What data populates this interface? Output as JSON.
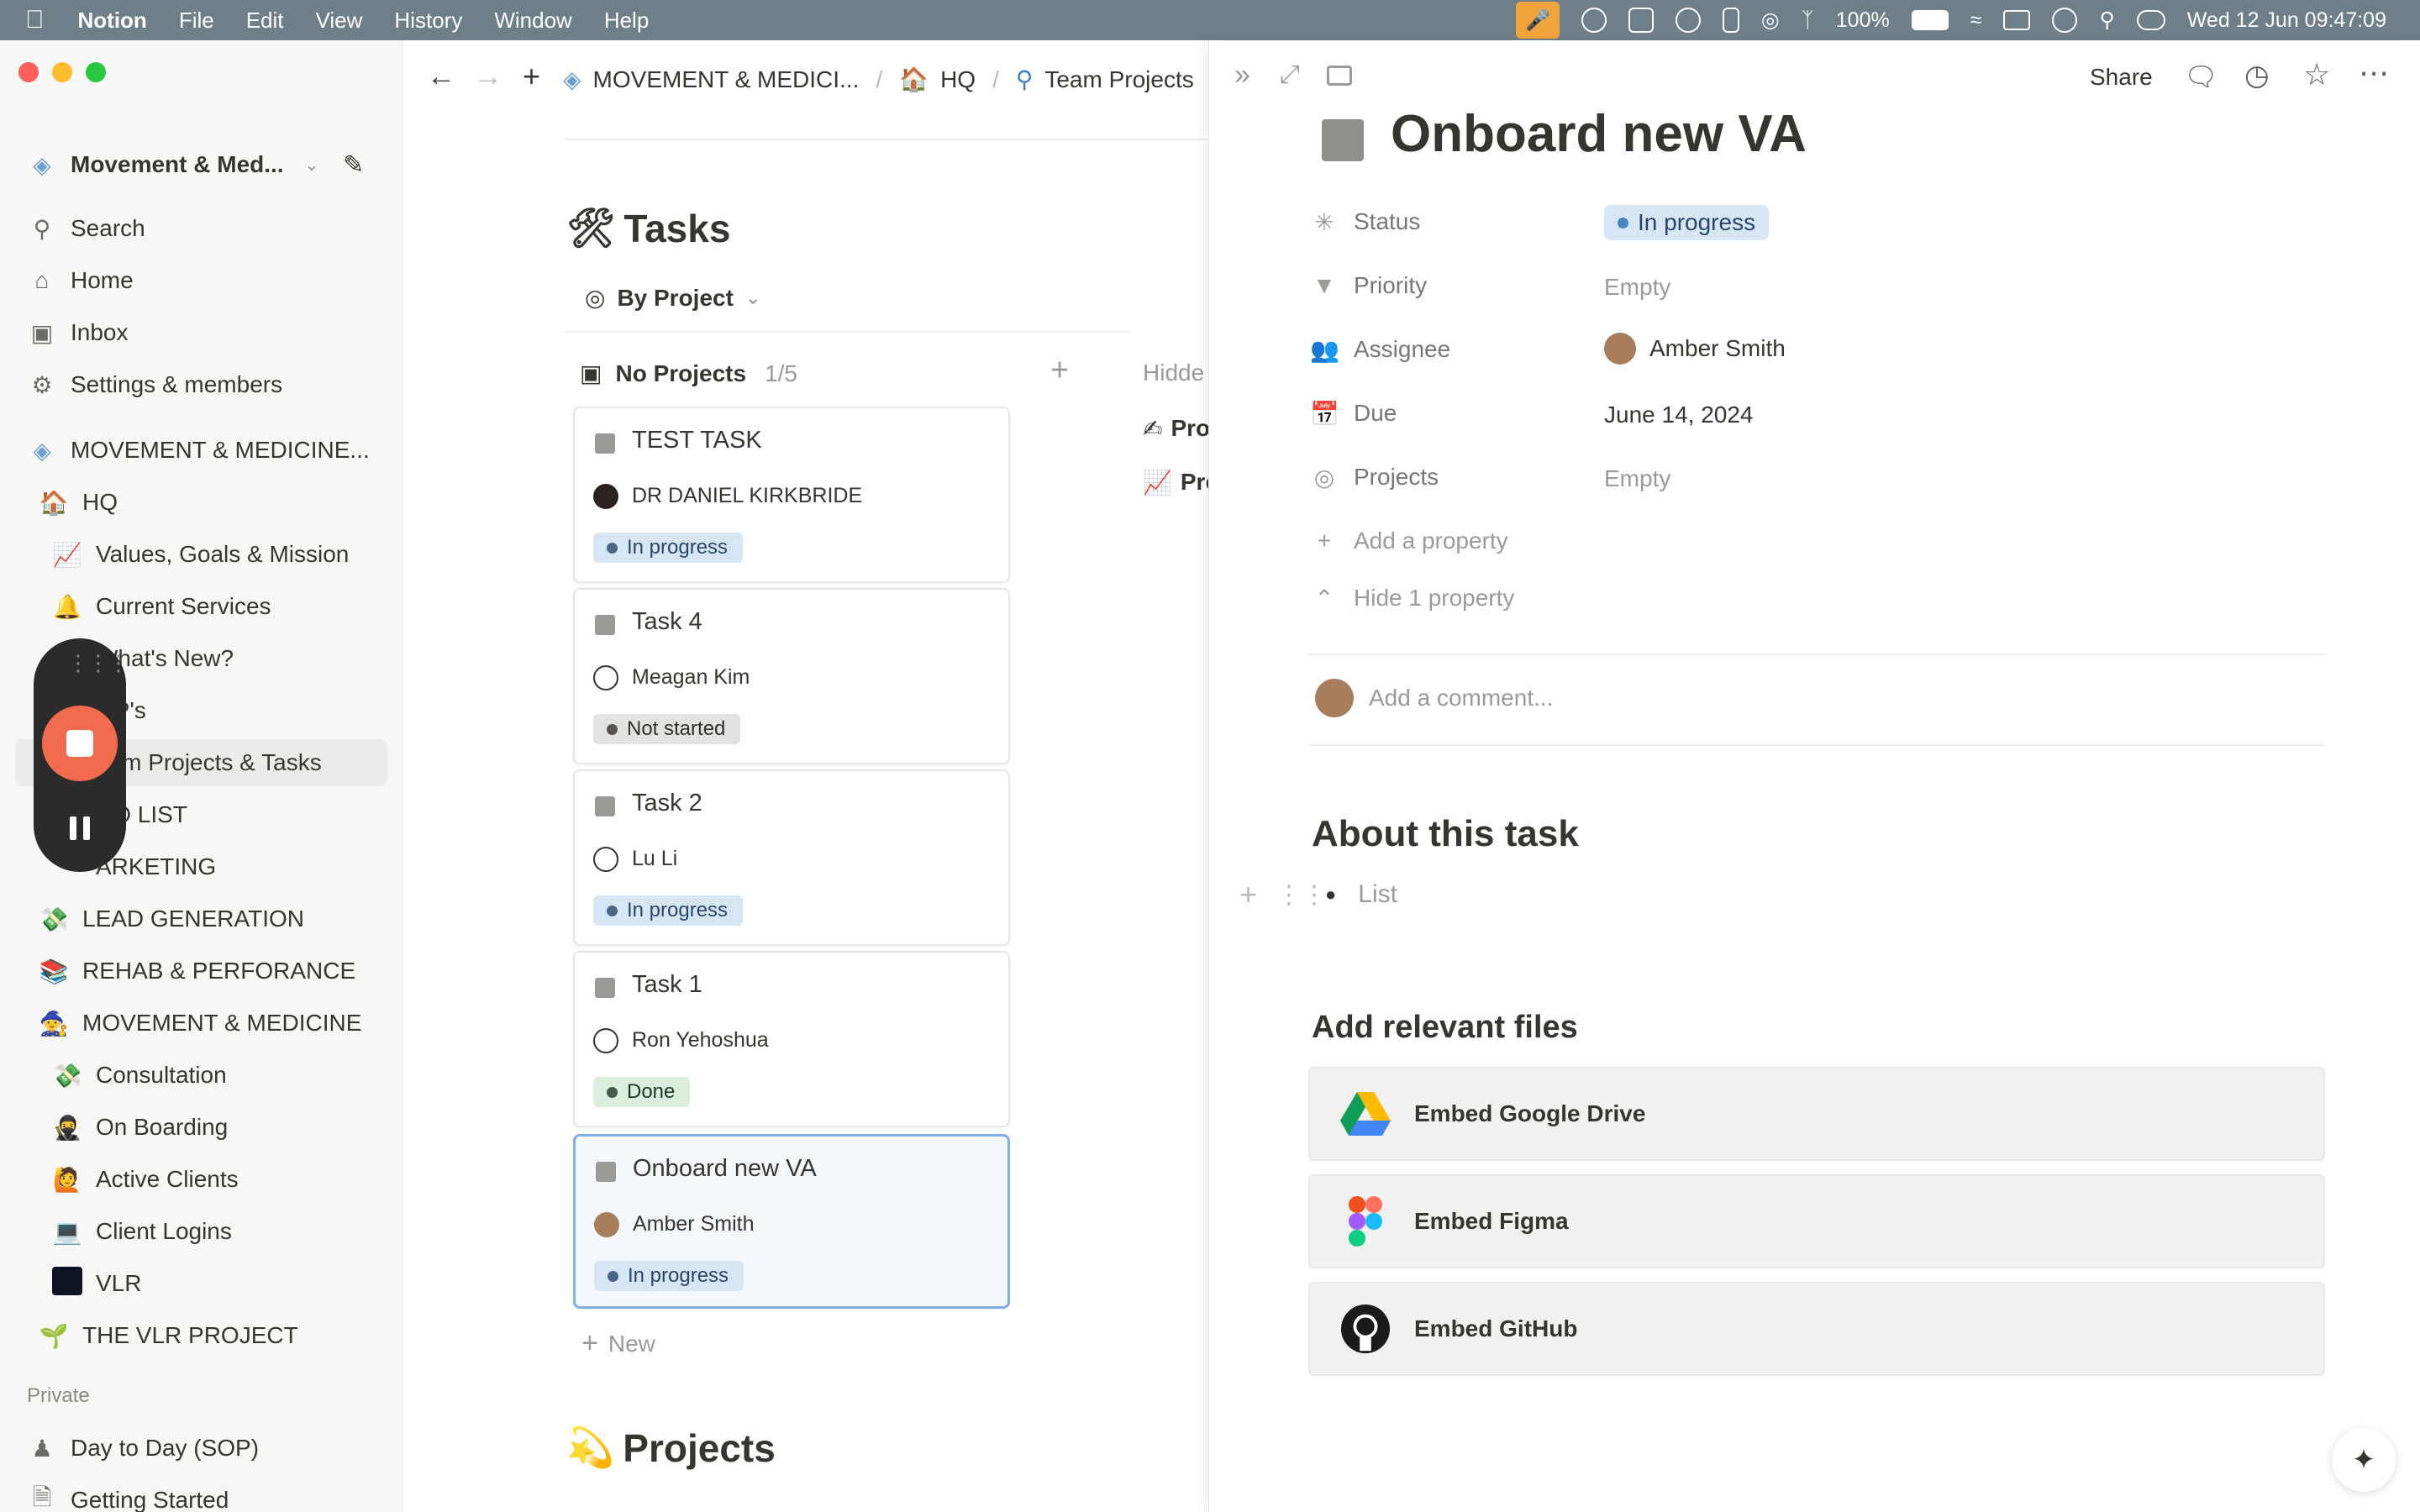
{
  "menubar": {
    "app_name": "Notion",
    "menus": [
      "File",
      "Edit",
      "View",
      "History",
      "Window",
      "Help"
    ],
    "battery": "100%",
    "datetime": "Wed 12 Jun  09:47:09"
  },
  "sidebar": {
    "workspace_name": "Movement & Med...",
    "nav": {
      "search": "Search",
      "home": "Home",
      "inbox": "Inbox",
      "settings": "Settings & members"
    },
    "teamspace_title": "MOVEMENT & MEDICINE...",
    "pages": {
      "hq": "HQ",
      "values": "Values, Goals & Mission",
      "current_services": "Current Services",
      "whats_new": "What's New?",
      "sops": "OP's",
      "team_projects": "eam Projects & Tasks",
      "todo": "DO LIST",
      "marketing": "ARKETING",
      "lead_gen": "LEAD GENERATION",
      "rehab": "REHAB & PERFORANCE",
      "movement": "MOVEMENT & MEDICINE",
      "consultation": "Consultation",
      "onboarding": "On Boarding",
      "active_clients": "Active Clients",
      "client_logins": "Client Logins",
      "vlr": "VLR",
      "vlr_project": "THE VLR PROJECT"
    },
    "private_header": "Private",
    "private": {
      "day_to_day": "Day to Day (SOP)",
      "getting_started": "Getting Started"
    }
  },
  "topbar": {
    "breadcrumb_1": "MOVEMENT & MEDICI...",
    "breadcrumb_sep": "/",
    "breadcrumb_2": "HQ",
    "breadcrumb_3": "Team Projects"
  },
  "board": {
    "title": "Tasks",
    "view_label": "By Project",
    "group_label": "No Projects",
    "group_count": "1/5",
    "hidden_label": "Hidde",
    "hidden_item_1": "Pro",
    "hidden_item_2": "Pro",
    "new_label": "New",
    "cards": [
      {
        "title": "TEST TASK",
        "person": "DR DANIEL KIRKBRIDE",
        "status": "In progress"
      },
      {
        "title": "Task 4",
        "person": "Meagan Kim",
        "status": "Not started"
      },
      {
        "title": "Task 2",
        "person": "Lu Li",
        "status": "In progress"
      },
      {
        "title": "Task 1",
        "person": "Ron Yehoshua",
        "status": "Done"
      },
      {
        "title": "Onboard new VA",
        "person": "Amber Smith",
        "status": "In progress"
      }
    ],
    "projects_title": "Projects"
  },
  "panel": {
    "share_label": "Share",
    "page_title": "Onboard new VA",
    "props": {
      "status_label": "Status",
      "status_value": "In progress",
      "priority_label": "Priority",
      "priority_value": "Empty",
      "assignee_label": "Assignee",
      "assignee_value": "Amber Smith",
      "due_label": "Due",
      "due_value": "June 14, 2024",
      "projects_label": "Projects",
      "projects_value": "Empty"
    },
    "add_property": "Add a property",
    "hide_property": "Hide 1 property",
    "comment_placeholder": "Add a comment...",
    "about_heading": "About this task",
    "list_placeholder": "List",
    "files_heading": "Add relevant files",
    "embeds": {
      "gdrive": "Embed Google Drive",
      "figma": "Embed Figma",
      "github": "Embed GitHub"
    }
  }
}
